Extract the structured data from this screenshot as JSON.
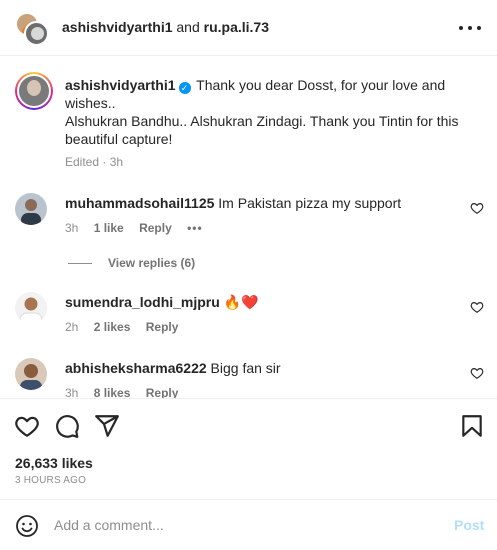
{
  "header": {
    "user1": "ashishvidyarthi1",
    "and": "and",
    "user2": "ru.pa.li.73"
  },
  "caption": {
    "username": "ashishvidyarthi1",
    "verified_icon": "verified-badge-icon",
    "line1": "Thank you dear Dosst, for your love and wishes..",
    "line2": "Alshukran Bandhu.. Alshukran Zindagi. Thank you Tintin for this beautiful capture!",
    "meta": "Edited · 3h"
  },
  "comments": [
    {
      "username": "muhammadsohail1125",
      "text": "Im Pakistan pizza my support",
      "time": "3h",
      "likes": "1 like",
      "reply": "Reply",
      "more": "•••"
    },
    {
      "username": "sumendra_lodhi_mjpru",
      "text": "🔥❤️",
      "time": "2h",
      "likes": "2 likes",
      "reply": "Reply"
    },
    {
      "username": "abhisheksharma6222",
      "text": "Bigg fan sir",
      "time": "3h",
      "likes": "8 likes",
      "reply": "Reply"
    }
  ],
  "view_replies": "View replies (6)",
  "actions": {
    "likes": "26,633 likes",
    "timeago": "3 HOURS AGO"
  },
  "add_comment": {
    "placeholder": "Add a comment...",
    "post_label": "Post"
  },
  "colors": {
    "accent": "#0095f6",
    "post_disabled": "#b2dffc",
    "secondary_text": "#8e8e8e"
  }
}
